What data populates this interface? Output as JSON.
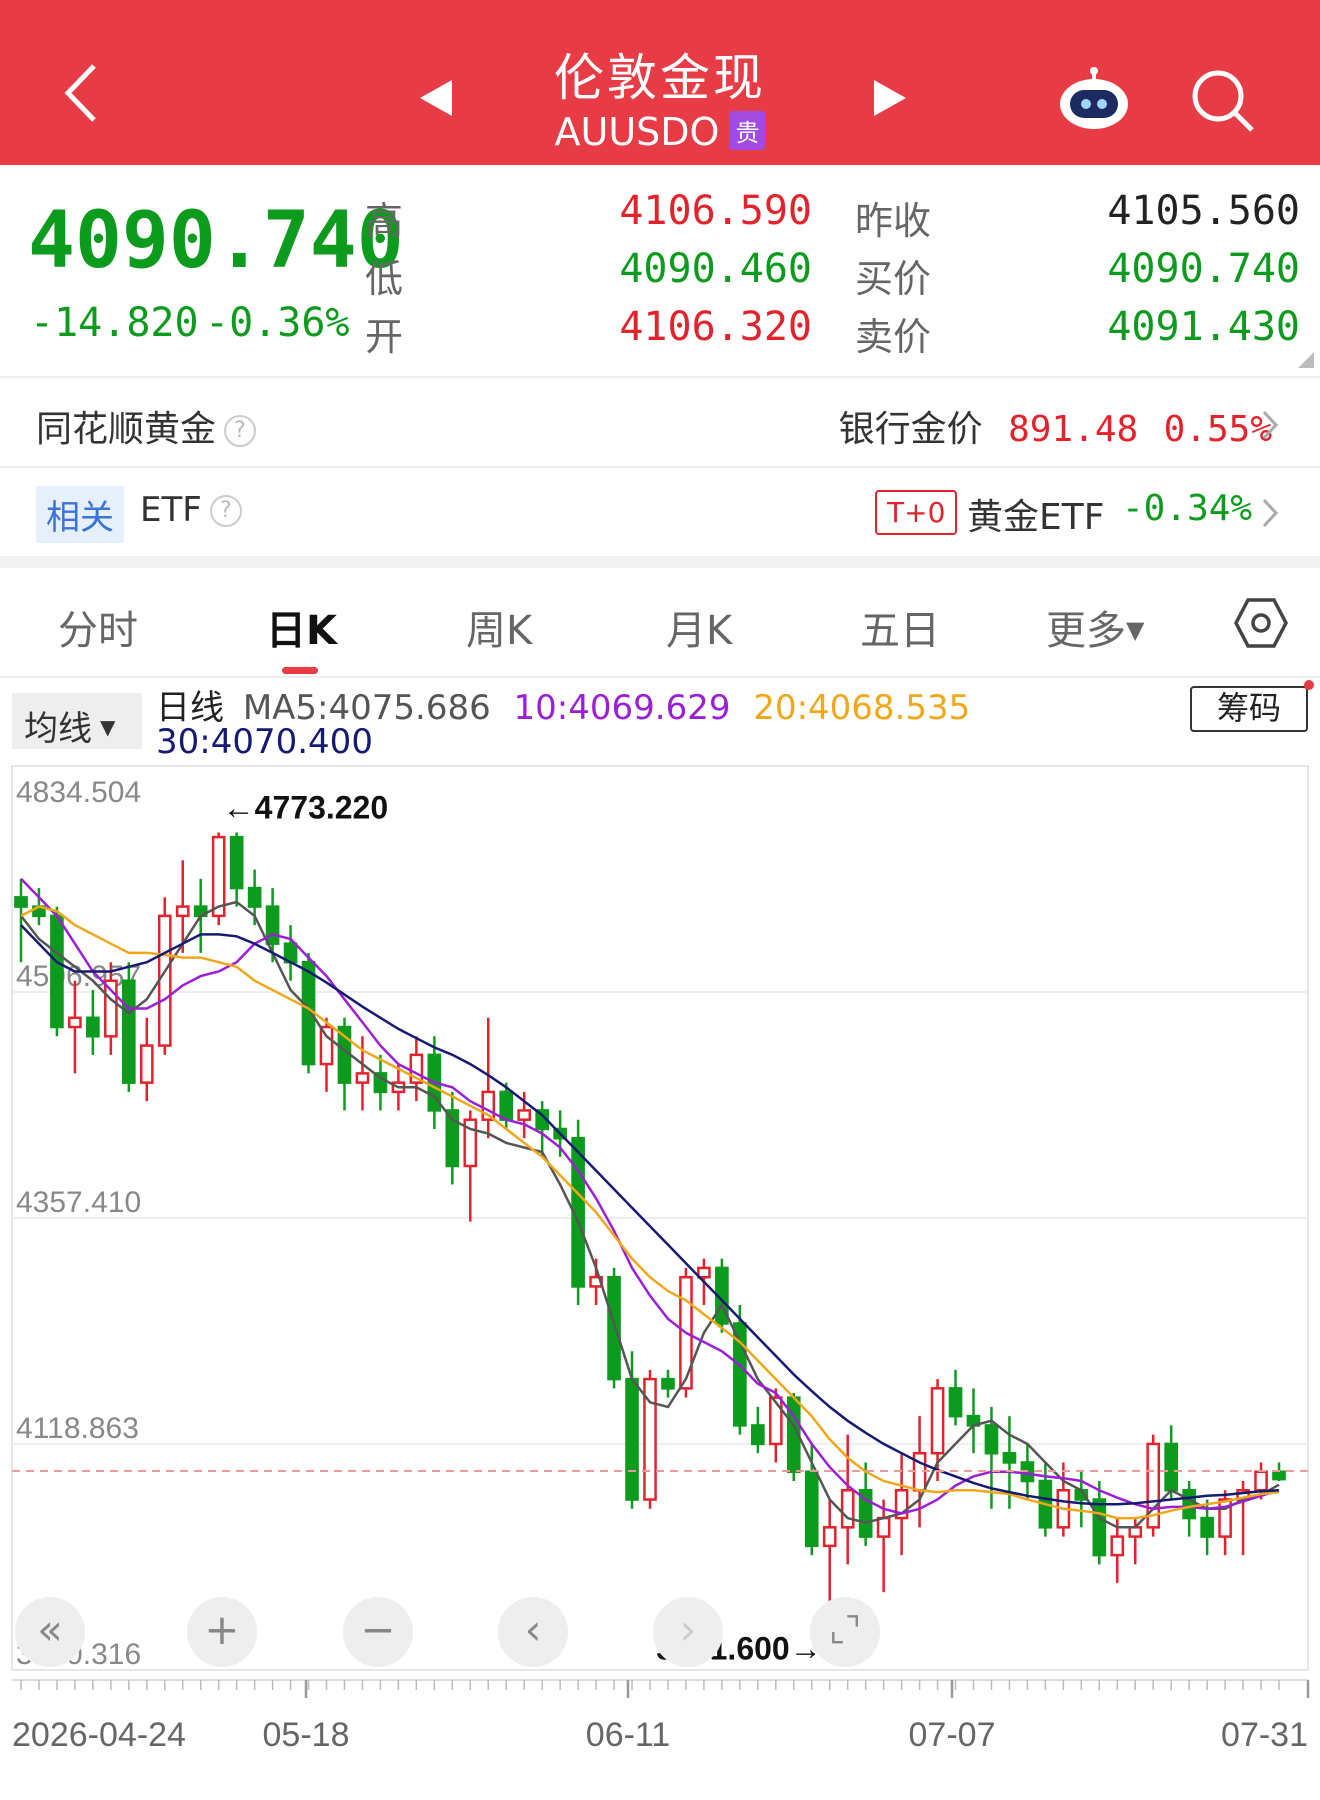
{
  "header": {
    "title": "伦敦金现",
    "symbol": "AUUSDO",
    "tag": "贵"
  },
  "quote": {
    "price": "4090.740",
    "change": "-14.820",
    "change_pct": "-0.36%",
    "high_label": "高",
    "low_label": "低",
    "open_label": "开",
    "high": "4106.590",
    "low": "4090.460",
    "open": "4106.320",
    "prev_close_label": "昨收",
    "bid_label": "买价",
    "ask_label": "卖价",
    "prev_close": "4105.560",
    "bid": "4090.740",
    "ask": "4091.430"
  },
  "gold": {
    "name": "同花顺黄金",
    "bank_label": "银行金价",
    "bank_price": "891.48",
    "bank_pct": "0.55%"
  },
  "etf": {
    "related": "相关",
    "name": "ETF",
    "t0": "T+0",
    "etf_label": "黄金ETF",
    "etf_pct": "-0.34%"
  },
  "tabs": [
    "分时",
    "日K",
    "周K",
    "月K",
    "五日",
    "更多"
  ],
  "chart_header": {
    "ma_select": "均线",
    "label": "日线",
    "ma5": "MA5:4075.686",
    "ma10": "10:4069.629",
    "ma20": "20:4068.535",
    "ma30": "30:4070.400",
    "chips": "筹码"
  },
  "colors": {
    "up": "#e2232c",
    "down": "#0d9b1e",
    "ma5": "#555555",
    "ma10": "#9a1fd6",
    "ma20": "#f0a81a",
    "ma30": "#151a72",
    "header": "#e73b45"
  },
  "chart_data": {
    "type": "candlestick",
    "y_ticks": [
      "4834.504",
      "4596.957",
      "4357.410",
      "4118.863",
      "3880.316"
    ],
    "ylim": [
      3880.316,
      4834.504
    ],
    "x_ticks": [
      "2026-04-24",
      "05-18",
      "06-11",
      "07-07",
      "07-31"
    ],
    "max_label": "←4773.220",
    "min_label": "3941.600→",
    "current": 4090.74,
    "ohlc": [
      [
        4710,
        4730,
        4640,
        4700
      ],
      [
        4700,
        4720,
        4680,
        4690
      ],
      [
        4690,
        4700,
        4560,
        4570
      ],
      [
        4570,
        4620,
        4520,
        4580
      ],
      [
        4580,
        4610,
        4540,
        4560
      ],
      [
        4560,
        4640,
        4540,
        4620
      ],
      [
        4620,
        4640,
        4500,
        4510
      ],
      [
        4510,
        4580,
        4490,
        4550
      ],
      [
        4550,
        4710,
        4540,
        4690
      ],
      [
        4690,
        4750,
        4650,
        4700
      ],
      [
        4700,
        4730,
        4650,
        4690
      ],
      [
        4690,
        4780,
        4680,
        4775
      ],
      [
        4775,
        4780,
        4700,
        4720
      ],
      [
        4720,
        4740,
        4680,
        4700
      ],
      [
        4700,
        4720,
        4640,
        4660
      ],
      [
        4660,
        4680,
        4620,
        4640
      ],
      [
        4640,
        4650,
        4520,
        4530
      ],
      [
        4530,
        4580,
        4500,
        4570
      ],
      [
        4570,
        4580,
        4480,
        4510
      ],
      [
        4510,
        4560,
        4480,
        4520
      ],
      [
        4520,
        4540,
        4480,
        4500
      ],
      [
        4500,
        4530,
        4480,
        4510
      ],
      [
        4510,
        4560,
        4490,
        4540
      ],
      [
        4540,
        4560,
        4460,
        4480
      ],
      [
        4480,
        4500,
        4400,
        4420
      ],
      [
        4420,
        4480,
        4360,
        4470
      ],
      [
        4470,
        4580,
        4450,
        4500
      ],
      [
        4500,
        4510,
        4460,
        4470
      ],
      [
        4470,
        4500,
        4450,
        4480
      ],
      [
        4480,
        4490,
        4430,
        4460
      ],
      [
        4460,
        4480,
        4430,
        4450
      ],
      [
        4450,
        4470,
        4270,
        4290
      ],
      [
        4290,
        4320,
        4270,
        4300
      ],
      [
        4300,
        4310,
        4180,
        4190
      ],
      [
        4190,
        4220,
        4050,
        4060
      ],
      [
        4060,
        4200,
        4050,
        4190
      ],
      [
        4190,
        4200,
        4170,
        4180
      ],
      [
        4180,
        4310,
        4170,
        4300
      ],
      [
        4300,
        4320,
        4270,
        4310
      ],
      [
        4310,
        4320,
        4240,
        4250
      ],
      [
        4250,
        4270,
        4130,
        4140
      ],
      [
        4140,
        4160,
        4110,
        4120
      ],
      [
        4120,
        4180,
        4100,
        4170
      ],
      [
        4170,
        4175,
        4080,
        4090
      ],
      [
        4090,
        4120,
        4000,
        4010
      ],
      [
        4010,
        4060,
        3950,
        4030
      ],
      [
        4030,
        4130,
        3990,
        4070
      ],
      [
        4070,
        4100,
        4010,
        4020
      ],
      [
        4020,
        4060,
        3960,
        4040
      ],
      [
        4040,
        4110,
        4000,
        4070
      ],
      [
        4070,
        4150,
        4030,
        4110
      ],
      [
        4110,
        4190,
        4080,
        4180
      ],
      [
        4180,
        4200,
        4140,
        4150
      ],
      [
        4150,
        4180,
        4110,
        4140
      ],
      [
        4140,
        4160,
        4050,
        4110
      ],
      [
        4110,
        4150,
        4050,
        4100
      ],
      [
        4100,
        4120,
        4060,
        4080
      ],
      [
        4080,
        4100,
        4020,
        4030
      ],
      [
        4030,
        4100,
        4020,
        4070
      ],
      [
        4070,
        4090,
        4030,
        4060
      ],
      [
        4060,
        4080,
        3990,
        4000
      ],
      [
        4000,
        4040,
        3970,
        4020
      ],
      [
        4020,
        4040,
        3990,
        4030
      ],
      [
        4030,
        4130,
        4020,
        4120
      ],
      [
        4120,
        4140,
        4060,
        4070
      ],
      [
        4070,
        4080,
        4020,
        4040
      ],
      [
        4040,
        4060,
        4000,
        4020
      ],
      [
        4020,
        4070,
        4000,
        4060
      ],
      [
        4060,
        4080,
        4000,
        4070
      ],
      [
        4070,
        4100,
        4060,
        4090
      ],
      [
        4090,
        4100,
        4080,
        4082
      ]
    ],
    "ma": {
      "ma5": [
        4690,
        4665,
        4650,
        4635,
        4620,
        4600,
        4585,
        4600,
        4630,
        4660,
        4690,
        4700,
        4705,
        4690,
        4650,
        4610,
        4590,
        4560,
        4545,
        4530,
        4515,
        4505,
        4505,
        4495,
        4470,
        4460,
        4455,
        4445,
        4440,
        4435,
        4400,
        4360,
        4310,
        4250,
        4190,
        4165,
        4160,
        4190,
        4240,
        4270,
        4230,
        4190,
        4165,
        4140,
        4100,
        4060,
        4040,
        4035,
        4040,
        4045,
        4060,
        4100,
        4120,
        4140,
        4145,
        4130,
        4120,
        4100,
        4080,
        4070,
        4040,
        4030,
        4030,
        4050,
        4070,
        4060,
        4050,
        4050,
        4060,
        4065,
        4076
      ],
      "ma10": [
        4730,
        4710,
        4690,
        4660,
        4630,
        4610,
        4590,
        4590,
        4600,
        4615,
        4625,
        4630,
        4640,
        4660,
        4670,
        4665,
        4645,
        4625,
        4600,
        4575,
        4550,
        4530,
        4520,
        4510,
        4505,
        4490,
        4480,
        4470,
        4465,
        4455,
        4440,
        4415,
        4385,
        4350,
        4310,
        4280,
        4255,
        4240,
        4230,
        4220,
        4205,
        4185,
        4175,
        4150,
        4120,
        4095,
        4075,
        4060,
        4050,
        4045,
        4050,
        4060,
        4075,
        4085,
        4090,
        4090,
        4088,
        4085,
        4083,
        4080,
        4070,
        4062,
        4055,
        4050,
        4052,
        4052,
        4050,
        4052,
        4058,
        4064,
        4070
      ],
      "ma20": [
        4690,
        4700,
        4695,
        4680,
        4670,
        4660,
        4650,
        4650,
        4648,
        4645,
        4645,
        4640,
        4635,
        4620,
        4610,
        4600,
        4590,
        4575,
        4560,
        4545,
        4535,
        4525,
        4515,
        4505,
        4495,
        4485,
        4475,
        4460,
        4445,
        4430,
        4410,
        4390,
        4370,
        4345,
        4320,
        4300,
        4285,
        4275,
        4260,
        4245,
        4230,
        4210,
        4190,
        4170,
        4150,
        4125,
        4105,
        4090,
        4080,
        4075,
        4070,
        4068,
        4070,
        4070,
        4068,
        4066,
        4060,
        4055,
        4050,
        4048,
        4045,
        4040,
        4040,
        4043,
        4048,
        4052,
        4055,
        4058,
        4062,
        4066,
        4068
      ],
      "ma30": [
        4680,
        4660,
        4640,
        4630,
        4630,
        4630,
        4635,
        4640,
        4650,
        4660,
        4670,
        4670,
        4668,
        4660,
        4650,
        4640,
        4630,
        4618,
        4605,
        4592,
        4580,
        4568,
        4558,
        4548,
        4540,
        4530,
        4518,
        4505,
        4490,
        4475,
        4455,
        4435,
        4415,
        4395,
        4375,
        4355,
        4335,
        4315,
        4295,
        4275,
        4255,
        4235,
        4215,
        4195,
        4177,
        4160,
        4145,
        4132,
        4120,
        4110,
        4100,
        4092,
        4085,
        4078,
        4072,
        4068,
        4064,
        4061,
        4058,
        4056,
        4055,
        4055,
        4056,
        4058,
        4060,
        4062,
        4064,
        4065,
        4067,
        4069,
        4070
      ]
    }
  }
}
